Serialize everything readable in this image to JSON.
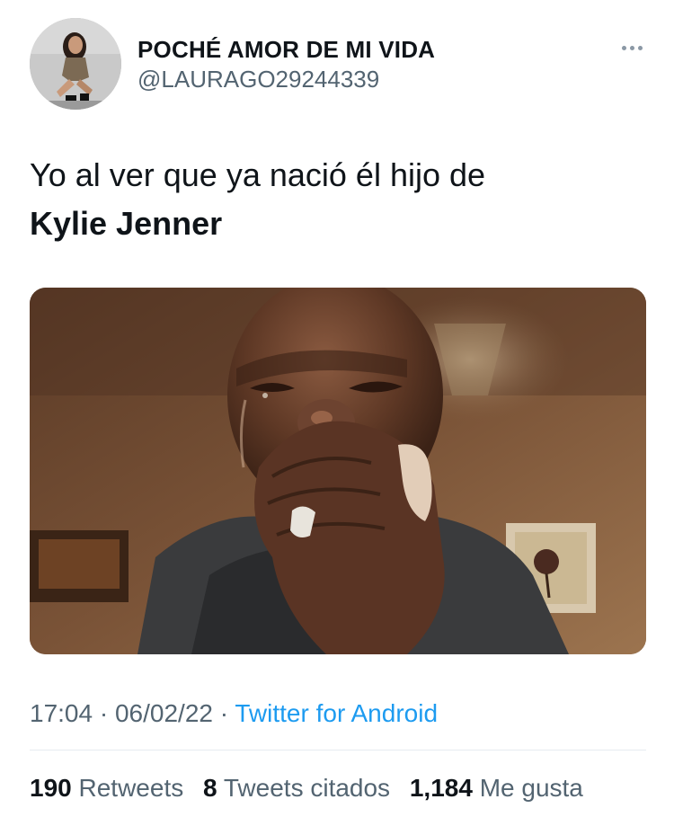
{
  "user": {
    "display_name": "POCHÉ AMOR DE MI VIDA",
    "handle": "@LAURAGO29244339"
  },
  "tweet": {
    "text_line1": "Yo al ver que ya nació él hijo de",
    "text_line2": "Kylie Jenner",
    "time": "17:04",
    "date": "06/02/22",
    "separator": "·",
    "source": "Twitter for Android"
  },
  "stats": {
    "retweets_count": "190",
    "retweets_label": "Retweets",
    "quotes_count": "8",
    "quotes_label": "Tweets citados",
    "likes_count": "1,184",
    "likes_label": "Me gusta"
  },
  "icons": {
    "more": "more-options-icon"
  },
  "colors": {
    "link": "#1d9bf0",
    "secondary_text": "#536471",
    "primary_text": "#0f1419"
  }
}
